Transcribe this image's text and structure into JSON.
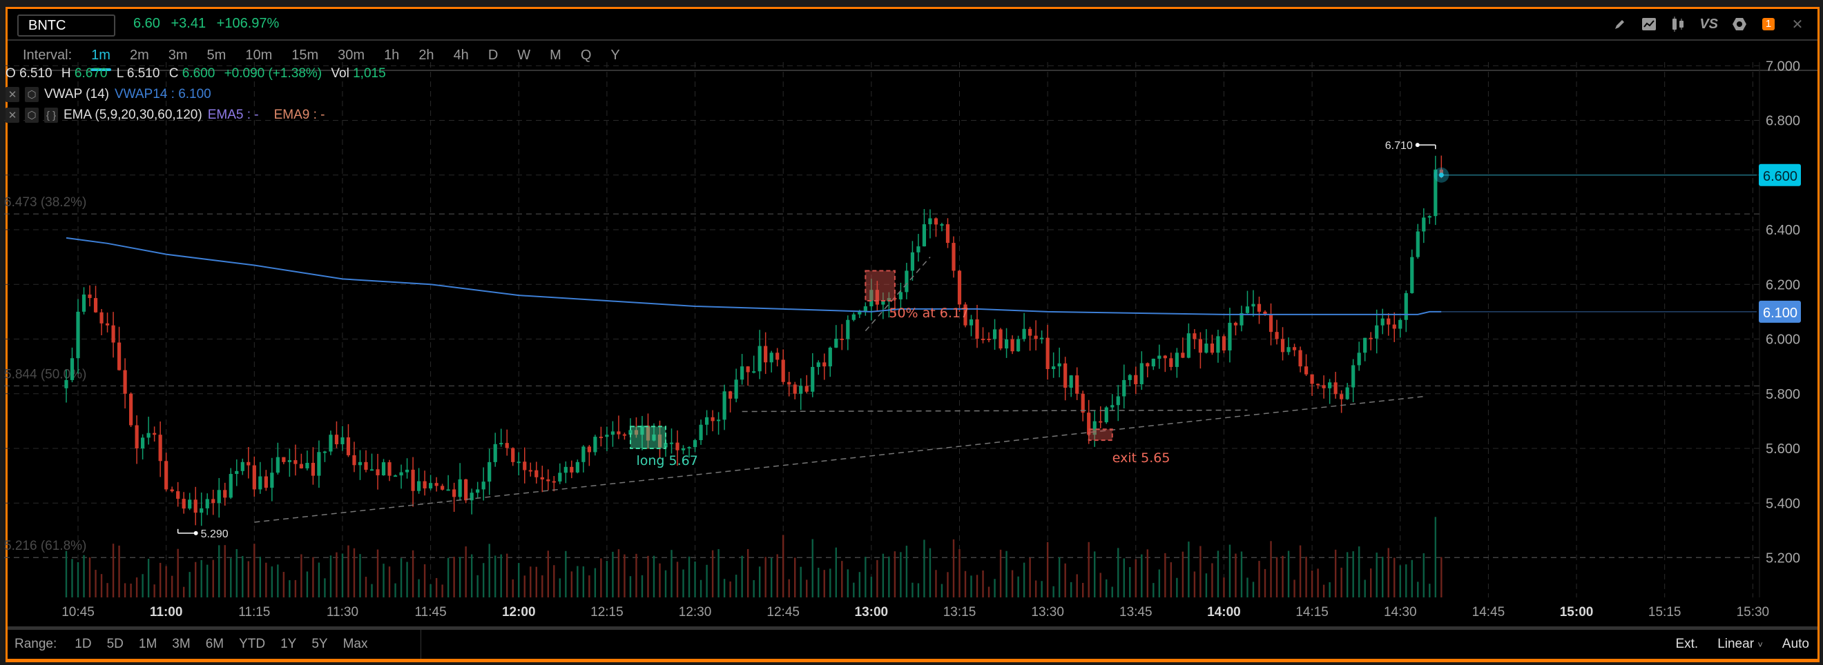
{
  "header": {
    "symbol": "BNTC",
    "last": "6.60",
    "change": "+3.41",
    "change_pct": "+106.97%",
    "alert_count": "1"
  },
  "toolbar": {
    "icons": [
      "pencil-icon",
      "chart-style-icon",
      "candles-icon",
      "compare-icon",
      "gear-icon",
      "alert-badge",
      "close-icon"
    ],
    "vs_label": "VS",
    "close_glyph": "✕"
  },
  "intervals": {
    "label": "Interval:",
    "items": [
      "1m",
      "2m",
      "3m",
      "5m",
      "10m",
      "15m",
      "30m",
      "1h",
      "2h",
      "4h",
      "D",
      "W",
      "M",
      "Q",
      "Y"
    ],
    "active": "1m"
  },
  "legend": {
    "o_label": "O",
    "o": "6.510",
    "h_label": "H",
    "h": "6.670",
    "l_label": "L",
    "l": "6.510",
    "c_label": "C",
    "c": "6.600",
    "chg": "+0.090 (+1.38%)",
    "vol_label": "Vol",
    "vol": "1,015",
    "vwap_name": "VWAP (14)",
    "vwap_val": "VWAP14 : 6.100",
    "ema_name": "EMA (5,9,20,30,60,120)",
    "ema5": "EMA5 : -",
    "ema9": "EMA9 : -",
    "braces": "{ }"
  },
  "range": {
    "label": "Range:",
    "items": [
      "1D",
      "5D",
      "1M",
      "3M",
      "6M",
      "YTD",
      "1Y",
      "5Y",
      "Max"
    ],
    "ext": "Ext.",
    "scale": "Linear",
    "auto": "Auto"
  },
  "colors": {
    "up": "#0e9f6e",
    "down": "#d23a2a",
    "vwap": "#3d7fd6",
    "accent": "#22c3e0",
    "border": "#ff7a00"
  },
  "chart_data": {
    "type": "candlestick",
    "ylim": [
      5.1,
      7.05
    ],
    "y_ticks": [
      "7.000",
      "6.800",
      "6.600",
      "6.400",
      "6.200",
      "6.000",
      "5.800",
      "5.600",
      "5.400",
      "5.200"
    ],
    "x_ticks": [
      "10:45",
      "11:00",
      "11:15",
      "11:30",
      "11:45",
      "12:00",
      "12:15",
      "12:30",
      "12:45",
      "13:00",
      "13:15",
      "13:30",
      "13:45",
      "14:00",
      "14:15",
      "14:30",
      "14:45",
      "15:00",
      "15:15",
      "15:30"
    ],
    "bold_x_ticks": [
      "11:00",
      "12:00",
      "13:00",
      "14:00",
      "15:00"
    ],
    "price_path": [
      [
        "10:43",
        5.85
      ],
      [
        "10:45",
        6.1
      ],
      [
        "10:47",
        6.15
      ],
      [
        "10:50",
        6.05
      ],
      [
        "10:53",
        5.8
      ],
      [
        "10:55",
        5.6
      ],
      [
        "10:58",
        5.65
      ],
      [
        "11:00",
        5.45
      ],
      [
        "11:03",
        5.38
      ],
      [
        "11:08",
        5.4
      ],
      [
        "11:13",
        5.55
      ],
      [
        "11:15",
        5.45
      ],
      [
        "11:20",
        5.55
      ],
      [
        "11:25",
        5.5
      ],
      [
        "11:28",
        5.65
      ],
      [
        "11:33",
        5.55
      ],
      [
        "11:38",
        5.5
      ],
      [
        "11:43",
        5.48
      ],
      [
        "11:48",
        5.45
      ],
      [
        "11:53",
        5.45
      ],
      [
        "11:57",
        5.62
      ],
      [
        "12:02",
        5.52
      ],
      [
        "12:05",
        5.48
      ],
      [
        "12:10",
        5.55
      ],
      [
        "12:15",
        5.65
      ],
      [
        "12:20",
        5.65
      ],
      [
        "12:25",
        5.62
      ],
      [
        "12:28",
        5.6
      ],
      [
        "12:33",
        5.7
      ],
      [
        "12:38",
        5.9
      ],
      [
        "12:43",
        5.95
      ],
      [
        "12:47",
        5.8
      ],
      [
        "12:52",
        5.9
      ],
      [
        "12:55",
        6.0
      ],
      [
        "12:58",
        6.1
      ],
      [
        "13:00",
        6.18
      ],
      [
        "13:03",
        6.15
      ],
      [
        "13:06",
        6.25
      ],
      [
        "13:09",
        6.42
      ],
      [
        "13:12",
        6.42
      ],
      [
        "13:14",
        6.25
      ],
      [
        "13:16",
        6.05
      ],
      [
        "13:20",
        6.0
      ],
      [
        "13:25",
        6.0
      ],
      [
        "13:28",
        6.0
      ],
      [
        "13:31",
        5.9
      ],
      [
        "13:35",
        5.8
      ],
      [
        "13:37",
        5.65
      ],
      [
        "13:40",
        5.75
      ],
      [
        "13:43",
        5.85
      ],
      [
        "13:47",
        5.9
      ],
      [
        "13:52",
        5.95
      ],
      [
        "13:55",
        6.0
      ],
      [
        "13:58",
        5.95
      ],
      [
        "14:02",
        6.05
      ],
      [
        "14:06",
        6.1
      ],
      [
        "14:09",
        6.0
      ],
      [
        "14:13",
        5.9
      ],
      [
        "14:17",
        5.82
      ],
      [
        "14:20",
        5.78
      ],
      [
        "14:23",
        5.95
      ],
      [
        "14:26",
        6.05
      ],
      [
        "14:30",
        6.07
      ],
      [
        "14:32",
        6.3
      ],
      [
        "14:35",
        6.45
      ],
      [
        "14:36",
        6.62
      ],
      [
        "14:37",
        6.6
      ]
    ],
    "vwap_path": [
      [
        "10:43",
        6.37
      ],
      [
        "10:50",
        6.35
      ],
      [
        "11:00",
        6.31
      ],
      [
        "11:15",
        6.27
      ],
      [
        "11:30",
        6.22
      ],
      [
        "11:45",
        6.2
      ],
      [
        "12:00",
        6.16
      ],
      [
        "12:15",
        6.14
      ],
      [
        "12:30",
        6.12
      ],
      [
        "12:45",
        6.11
      ],
      [
        "13:00",
        6.1
      ],
      [
        "13:05",
        6.11
      ],
      [
        "13:18",
        6.11
      ],
      [
        "13:30",
        6.1
      ],
      [
        "14:00",
        6.09
      ],
      [
        "14:33",
        6.09
      ],
      [
        "14:35",
        6.1
      ],
      [
        "14:37",
        6.1
      ]
    ],
    "last_price": {
      "time": "14:37",
      "value": 6.6,
      "label": "6.600"
    },
    "vwap_label": {
      "value": 6.1,
      "label": "6.100"
    },
    "fib_levels": [
      {
        "value": 6.473,
        "label": "6.473 (38.2%)"
      },
      {
        "value": 5.844,
        "label": "5.844 (50.0%)"
      },
      {
        "value": 5.216,
        "label": "5.216 (61.8%)"
      }
    ],
    "extremes": [
      {
        "time": "14:36",
        "value": 6.71,
        "label": "6.710",
        "side": "left"
      },
      {
        "time": "11:02",
        "value": 5.29,
        "label": "5.290",
        "side": "right"
      }
    ],
    "trendlines": [
      {
        "from": [
          "11:15",
          5.33
        ],
        "to": [
          "14:34",
          5.79
        ]
      },
      {
        "from": [
          "12:38",
          5.735
        ],
        "to": [
          "14:04",
          5.74
        ]
      },
      {
        "from": [
          "12:59",
          6.03
        ],
        "to": [
          "13:10",
          6.3
        ]
      }
    ],
    "annotations": [
      {
        "text": "50% at 6.17",
        "time": "13:03",
        "value": 6.08,
        "color": "#f06a5a",
        "box": {
          "t0": "12:59",
          "t1": "13:04",
          "p0": 6.25,
          "p1": 6.14,
          "color": "#d2504a"
        }
      },
      {
        "text": "long 5.67",
        "time": "12:20",
        "value": 5.54,
        "color": "#3ad3b0",
        "box": {
          "t0": "12:19",
          "t1": "12:25",
          "p0": 5.68,
          "p1": 5.6,
          "color": "#3fd9a0"
        }
      },
      {
        "text": "exit 5.65",
        "time": "13:41",
        "value": 5.55,
        "color": "#f06a5a",
        "box": {
          "t0": "13:37",
          "t1": "13:41",
          "p0": 5.67,
          "p1": 5.63,
          "color": "#d2504a"
        }
      }
    ]
  }
}
